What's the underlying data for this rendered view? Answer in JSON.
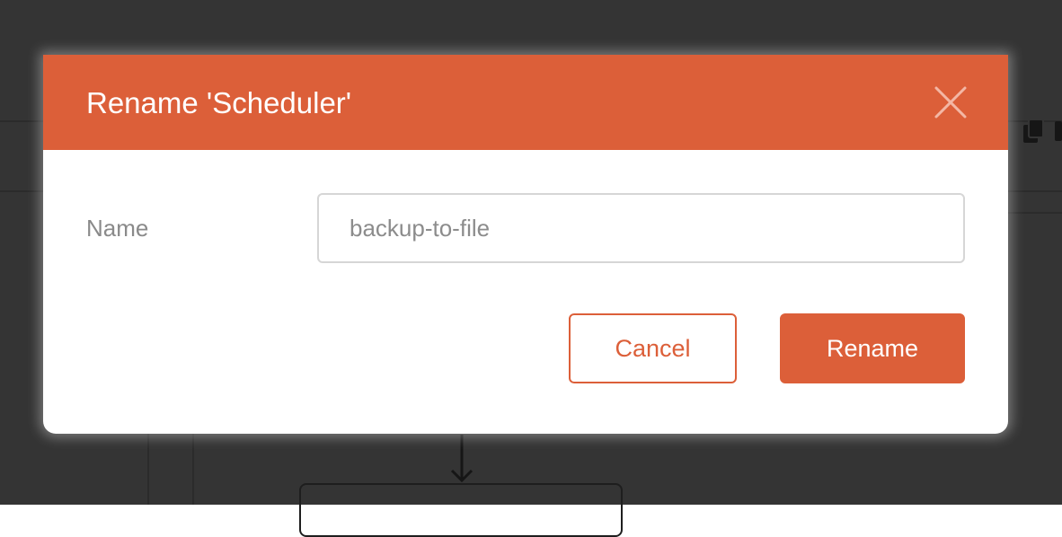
{
  "dialog": {
    "title": "Rename 'Scheduler'",
    "close_icon": "close-icon",
    "name_label": "Name",
    "name_value": "backup-to-file",
    "cancel_label": "Cancel",
    "rename_label": "Rename"
  },
  "colors": {
    "accent": "#dc5f39",
    "backdrop": "#343434",
    "dialog_bg": "#ffffff",
    "label_text": "#8a8a8a"
  },
  "background": {
    "icons": [
      "copy-icon"
    ]
  }
}
